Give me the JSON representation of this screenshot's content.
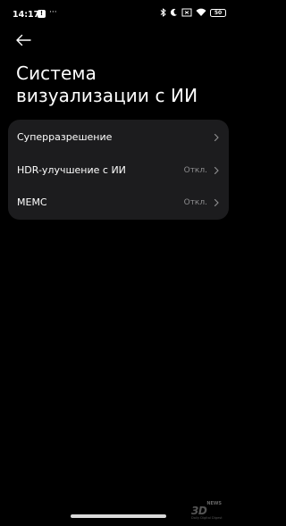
{
  "status_bar": {
    "time": "14:17",
    "notification_icon": "!",
    "dots": "···",
    "battery": "50",
    "icons": [
      "bluetooth-icon",
      "do-not-disturb-icon",
      "sim-signal-icon",
      "wifi-icon",
      "battery-icon"
    ]
  },
  "header": {
    "back_icon": "arrow-left-icon",
    "title": "Система визуализации с ИИ"
  },
  "settings": {
    "items": [
      {
        "label": "Суперразрешение",
        "value": ""
      },
      {
        "label": "HDR-улучшение с ИИ",
        "value": "Откл."
      },
      {
        "label": "MEMC",
        "value": "Откл."
      }
    ]
  },
  "watermark": {
    "logo": "3D",
    "news": "NEWS",
    "tagline": "Daily Digital Digest"
  },
  "colors": {
    "background": "#000000",
    "card": "#1c1c1e",
    "text_primary": "#ffffff",
    "text_secondary": "#8d8d8f"
  }
}
